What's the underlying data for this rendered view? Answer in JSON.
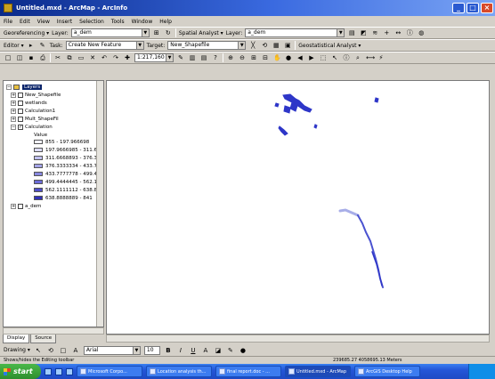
{
  "window": {
    "title": "Untitled.mxd - ArcMap - ArcInfo"
  },
  "menu": [
    "File",
    "Edit",
    "View",
    "Insert",
    "Selection",
    "Tools",
    "Window",
    "Help"
  ],
  "toolbar1": {
    "georeferencing_label": "Georeferencing ▾",
    "layer_label": "Layer:",
    "layer_value": "a_dem",
    "spatial_analyst_label": "Spatial Analyst ▾",
    "layer2_label": "Layer:",
    "layer2_value": "a_dem"
  },
  "toolbar2": {
    "editor_label": "Editor ▾",
    "task_label": "Task:",
    "task_value": "Create New Feature",
    "target_label": "Target:",
    "target_value": "New_Shapefile",
    "geostat_label": "Geostatistical Analyst ▾"
  },
  "toolbar3": {
    "scale_value": "1:217,160"
  },
  "toc": {
    "layers_label": "Layers",
    "items": [
      {
        "label": "New_Shapefile",
        "checked": false
      },
      {
        "label": "wetlands",
        "checked": false
      },
      {
        "label": "Calculation1",
        "checked": false
      },
      {
        "label": "Mult_ShapeFil",
        "checked": false
      }
    ],
    "calc_layer": "Calculation",
    "value_label": "Value",
    "legend": [
      {
        "label": "855 - 197.966698",
        "color": "#f2f2ff"
      },
      {
        "label": "197.9666985 - 311.6",
        "color": "#dcdcf8"
      },
      {
        "label": "311.6668893 - 376.33",
        "color": "#c0c0f0"
      },
      {
        "label": "376.3333334 - 433.7",
        "color": "#a4a4e8"
      },
      {
        "label": "433.7777778 - 499.4",
        "color": "#8888e0"
      },
      {
        "label": "499.4444445 - 562.1",
        "color": "#6c6cd8"
      },
      {
        "label": "562.1111112 - 638.8",
        "color": "#4e4ec8"
      },
      {
        "label": "638.8888889 - 841",
        "color": "#3232b8"
      }
    ],
    "last_item": "a_dem"
  },
  "toc_tabs": [
    "Display",
    "Source"
  ],
  "drawing": {
    "label": "Drawing ▾",
    "font_value": "Arial",
    "size_value": "10",
    "bold": "B",
    "italic": "I",
    "underline": "U"
  },
  "status": {
    "left": "Shows/hides the Editing toolbar",
    "coords": "239685.27 4058695.13 Meters"
  },
  "taskbar": {
    "start_label": "start",
    "tasks": [
      "Microsoft Corpo...",
      "Location analysis th...",
      "final report.doc - ...",
      "Untitled.mxd - ArcMap",
      "ArcGIS Desktop Help"
    ]
  },
  "colors": {
    "map_feature": "#2e36c8",
    "map_feature_light": "#9aa2e8",
    "selected": "#0a246a"
  }
}
